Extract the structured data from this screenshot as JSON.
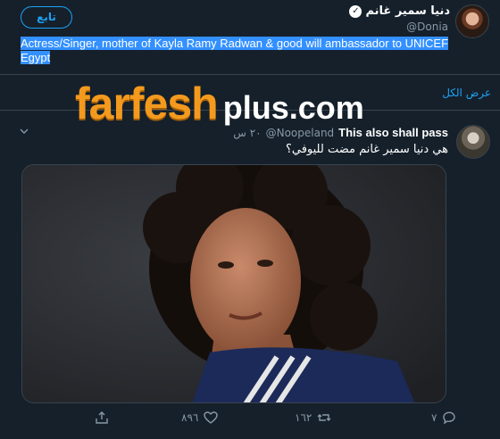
{
  "profile": {
    "name": "دنيا سمير غانم",
    "handle": "@Donia",
    "follow_label": "تابع",
    "bio": "Actress/Singer, mother of Kayla Ramy Radwan & good will ambassador to UNICEF Egypt"
  },
  "show_all_label": "عرض الكل",
  "watermark": {
    "brand": "farfesh",
    "suffix": "plus.com"
  },
  "tweet": {
    "author": "This also shall pass",
    "handle": "@Noopeland",
    "time": "٢٠ س",
    "text": "هي دنيا سمير غانم مضت لليوفي؟",
    "actions": {
      "replies": "٧",
      "retweets": "١٦٢",
      "likes": "٨٩٦"
    }
  },
  "colors": {
    "background": "#15202b",
    "accent": "#1da1f2",
    "muted": "#8899a6",
    "watermark_orange": "#f39a1e"
  },
  "icons": [
    "verified-icon",
    "chevron-down-icon",
    "reply-icon",
    "retweet-icon",
    "like-icon",
    "share-icon"
  ]
}
